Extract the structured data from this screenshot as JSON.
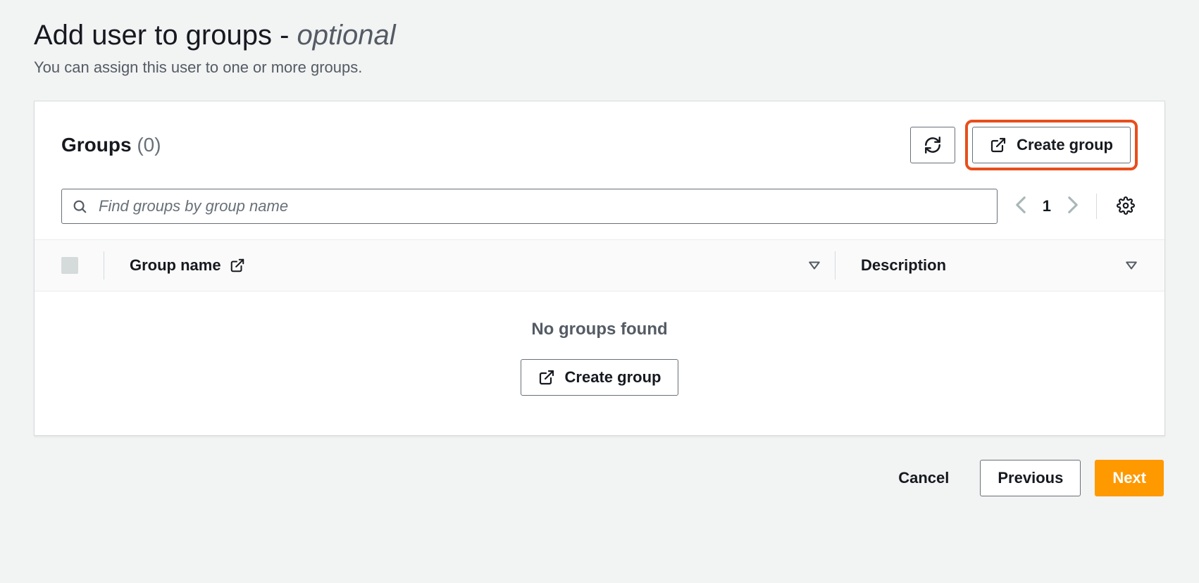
{
  "header": {
    "title_main": "Add user to groups",
    "title_sep": " - ",
    "title_optional": "optional",
    "subtitle": "You can assign this user to one or more groups."
  },
  "panel": {
    "title": "Groups",
    "count": "(0)",
    "create_group_label": "Create group"
  },
  "search": {
    "placeholder": "Find groups by group name"
  },
  "pagination": {
    "page": "1"
  },
  "table": {
    "col_group_name": "Group name",
    "col_description": "Description",
    "empty_message": "No groups found",
    "empty_create_label": "Create group"
  },
  "footer": {
    "cancel": "Cancel",
    "previous": "Previous",
    "next": "Next"
  }
}
